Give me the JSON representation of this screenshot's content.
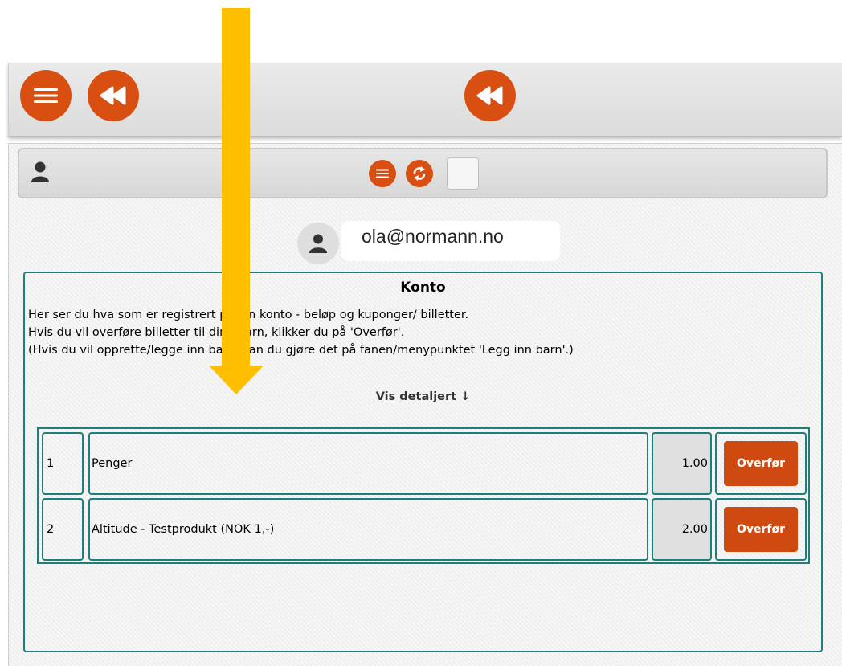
{
  "toolbar": {
    "menu_icon": "hamburger-menu-icon",
    "back_icon": "rewind-icon",
    "center_back_icon": "rewind-icon",
    "brand_color": "#d94f12"
  },
  "subbar": {
    "user_icon": "user-silhouette-icon",
    "menu_icon": "hamburger-menu-icon",
    "sync_icon": "sync-arrows-icon"
  },
  "user": {
    "email": "ola@normann.no"
  },
  "account": {
    "title": "Konto",
    "lines": [
      "Her ser du hva som er registrert på din konto - beløp og kuponger/ billetter.",
      "Hvis du vil overføre billetter til dine barn, klikker du på 'Overfør'.",
      "(Hvis du vil opprette/legge inn barn, kan du gjøre det på fanen/menypunktet 'Legg inn barn'.)"
    ],
    "detail_link": "Vis detaljert ↓",
    "rows": [
      {
        "num": "1",
        "name": "Penger",
        "amount": "1.00",
        "action": "Overfør"
      },
      {
        "num": "2",
        "name": "Altitude - Testprodukt (NOK 1,-)",
        "amount": "2.00",
        "action": "Overfør"
      }
    ],
    "accent_color": "#1e7f7a",
    "button_color": "#cf4a10"
  },
  "annotation": {
    "arrow_color": "#ffbf00"
  }
}
